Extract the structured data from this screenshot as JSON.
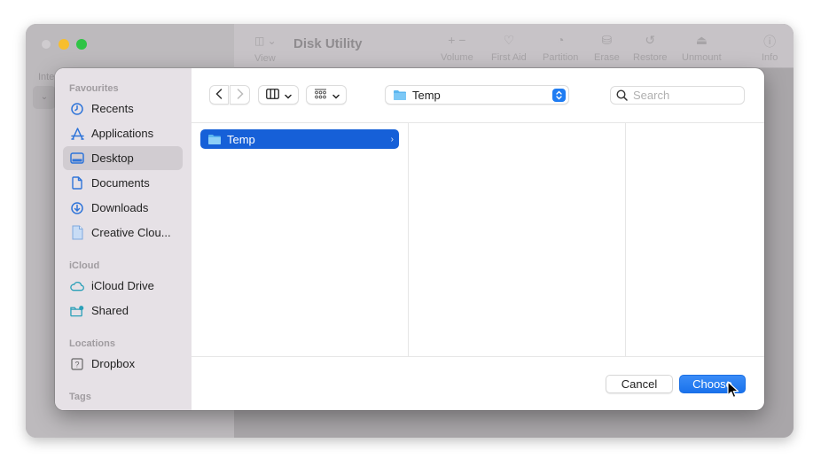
{
  "background_window": {
    "title": "Disk Utility",
    "sidebar_partial_label": "Inte",
    "view_label": "View",
    "toolbar": [
      {
        "icon": "plus-minus-icon",
        "label": "Volume"
      },
      {
        "icon": "stethoscope-icon",
        "label": "First Aid"
      },
      {
        "icon": "pie-chart-icon",
        "label": "Partition"
      },
      {
        "icon": "erase-icon",
        "label": "Erase"
      },
      {
        "icon": "restore-icon",
        "label": "Restore"
      },
      {
        "icon": "eject-icon",
        "label": "Unmount"
      },
      {
        "icon": "info-icon",
        "label": "Info"
      }
    ]
  },
  "dialog": {
    "sidebar": {
      "sections": [
        {
          "label": "Favourites",
          "items": [
            {
              "label": "Recents",
              "icon": "clock-icon",
              "selected": false
            },
            {
              "label": "Applications",
              "icon": "applications-icon",
              "selected": false
            },
            {
              "label": "Desktop",
              "icon": "desktop-icon",
              "selected": true
            },
            {
              "label": "Documents",
              "icon": "document-icon",
              "selected": false
            },
            {
              "label": "Downloads",
              "icon": "download-icon",
              "selected": false
            },
            {
              "label": "Creative Clou...",
              "icon": "file-icon",
              "selected": false
            }
          ]
        },
        {
          "label": "iCloud",
          "items": [
            {
              "label": "iCloud Drive",
              "icon": "cloud-icon",
              "selected": false
            },
            {
              "label": "Shared",
              "icon": "shared-folder-icon",
              "selected": false
            }
          ]
        },
        {
          "label": "Locations",
          "items": [
            {
              "label": "Dropbox",
              "icon": "unknown-drive-icon",
              "selected": false
            }
          ]
        },
        {
          "label": "Tags",
          "items": []
        }
      ]
    },
    "toolbar": {
      "path_popup_value": "Temp",
      "search_placeholder": "Search",
      "search_value": ""
    },
    "browser": {
      "columns": [
        {
          "items": [
            {
              "label": "Temp",
              "type": "folder",
              "selected": true
            }
          ]
        },
        {
          "items": []
        },
        {
          "items": []
        }
      ]
    },
    "buttons": {
      "cancel": "Cancel",
      "choose": "Choose"
    },
    "colors": {
      "accent": "#1660d8",
      "choose_button": "#1f7cf2",
      "sidebar_bg": "#e6e1e6"
    }
  }
}
